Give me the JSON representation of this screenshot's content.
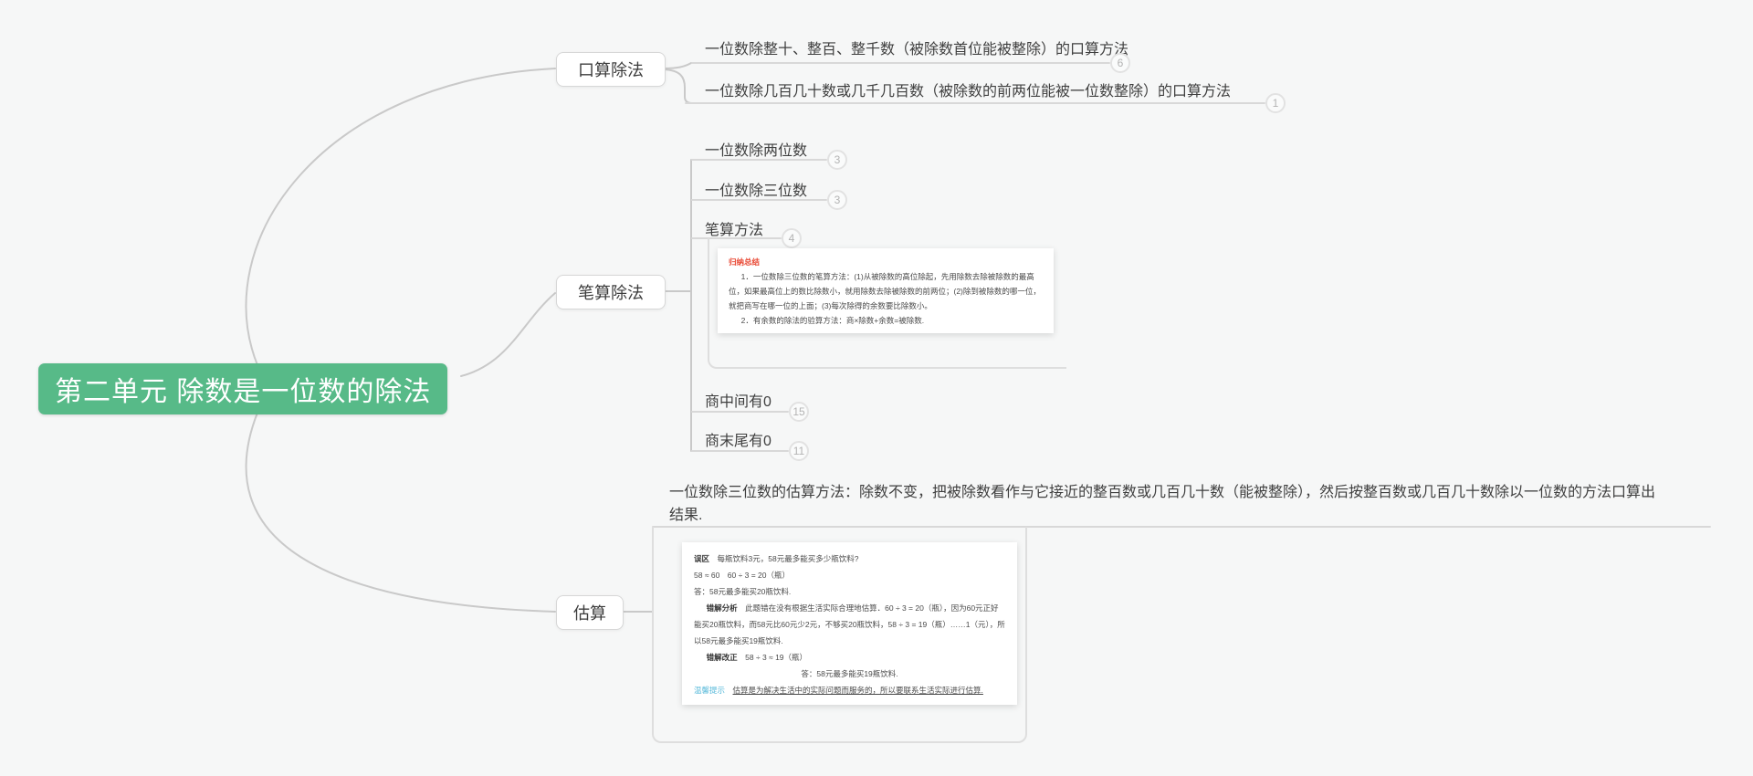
{
  "root": {
    "label": "第二单元 除数是一位数的除法",
    "color": "#57ba88"
  },
  "branches": [
    {
      "label": "口算除法",
      "children": [
        {
          "label": "一位数除整十、整百、整千数（被除数首位能被整除）的口算方法",
          "badge": "6"
        },
        {
          "label": "一位数除几百几十数或几千几百数（被除数的前两位能被一位数整除）的口算方法",
          "badge": "1"
        }
      ]
    },
    {
      "label": "笔算除法",
      "children": [
        {
          "label": "一位数除两位数",
          "badge": "3"
        },
        {
          "label": "一位数除三位数",
          "badge": "3"
        },
        {
          "label": "笔算方法",
          "badge": "4"
        },
        {
          "label": "商中间有0",
          "badge": "15"
        },
        {
          "label": "商末尾有0",
          "badge": "11"
        }
      ]
    },
    {
      "label": "估算",
      "children": [
        {
          "label": "一位数除三位数的估算方法：除数不变，把被除数看作与它接近的整百数或几百几十数（能被整除），然后按整百数或几百几十数除以一位数的方法口算出结果."
        }
      ]
    }
  ],
  "notes": {
    "bisuan": {
      "title": "归纳总结",
      "title_color": "#e8432e",
      "line1": "1．一位数除三位数的笔算方法：(1)从被除数的高位除起，先用除数去除被除数的最高位，如果最高位上的数比除数小，就用除数去除被除数的前两位；(2)除到被除数的哪一位，就把商写在哪一位的上面；(3)每次除得的余数要比除数小。",
      "line2": "2．有余数的除法的验算方法：商×除数+余数=被除数."
    },
    "gusuan": {
      "misconception_label": "误区",
      "misconception_text": "每瓶饮料3元，58元最多能买多少瓶饮料?",
      "calc_line": "58 ≈ 60　60 ÷ 3 = 20（瓶）",
      "answer_wrong": "答：58元最多能买20瓶饮料.",
      "analysis_label": "错解分析",
      "analysis_text": "此题错在没有根据生活实际合理地估算．60 ÷ 3 = 20（瓶），因为60元正好能买20瓶饮料，而58元比60元少2元，不够买20瓶饮料，58 ÷ 3 = 19（瓶）……1（元），所以58元最多能买19瓶饮料.",
      "correction_label": "错解改正",
      "correction_text": "58 ÷ 3 ≈ 19（瓶）",
      "answer_right": "答：58元最多能买19瓶饮料.",
      "tip_label": "温馨提示",
      "tip_label_color": "#55b8d9",
      "tip_text": "估算是为解决生活中的实际问题而服务的，所以要联系生活实际进行估算."
    }
  }
}
